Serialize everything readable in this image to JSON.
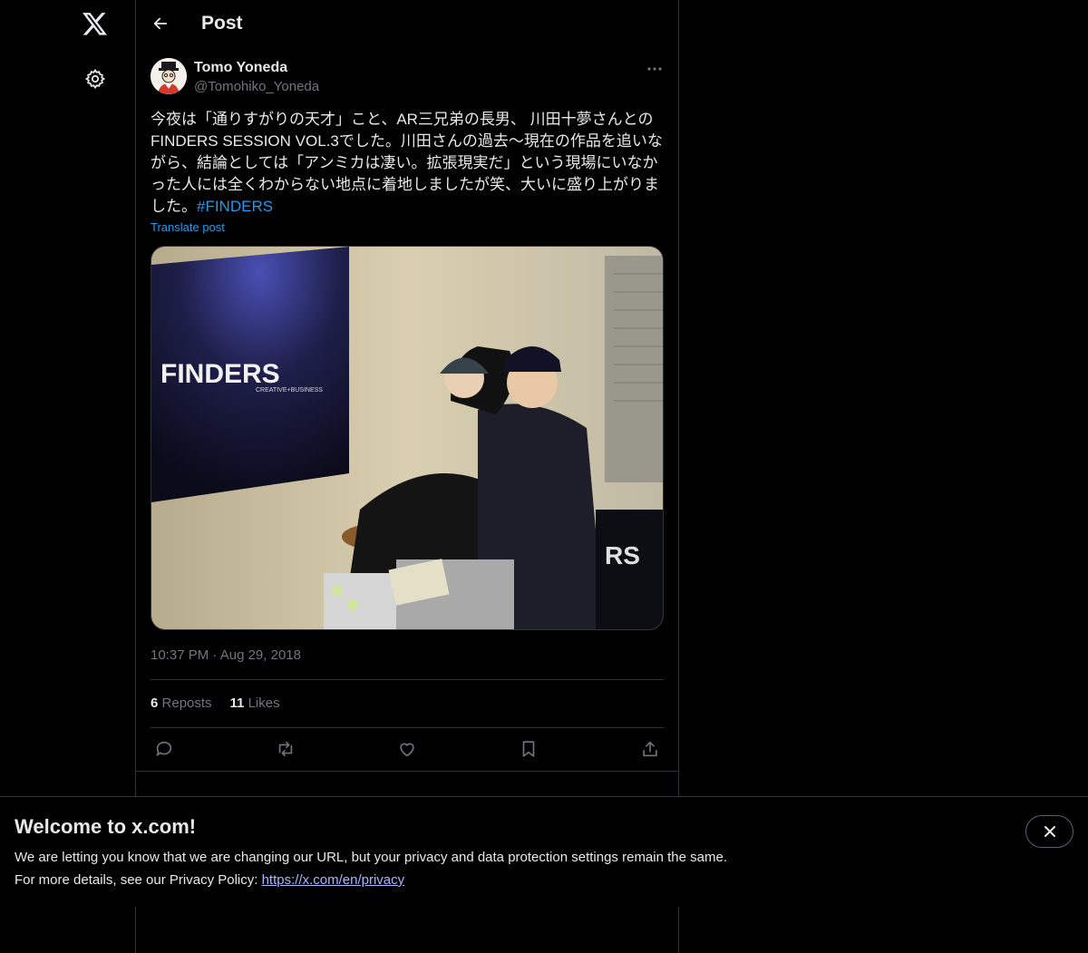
{
  "nav": {
    "logo_icon": "x-logo-icon",
    "settings_icon": "gear-icon"
  },
  "header": {
    "back_icon": "arrow-left-icon",
    "title": "Post"
  },
  "post": {
    "author_name": "Tomo Yoneda",
    "author_handle": "@Tomohiko_Yoneda",
    "text": "今夜は「通りすがりの天才」こと、AR三兄弟の長男、 川田十夢さんとのFINDERS SESSION VOL.3でした。川田さんの過去〜現在の作品を追いながら、結論としては「アンミカは凄い。拡張現実だ」という現場にいなかった人には全くわからない地点に着地しましたが笑、大いに盛り上がりました。",
    "hashtag": "#FINDERS",
    "translate_label": "Translate post",
    "photo_sign_text": "FINDERS",
    "photo_sign_subtext": "CREATIVE+BUSINESS",
    "time": "10:37 PM",
    "date_separator": "·",
    "date": "Aug 29, 2018",
    "reposts_count": "6",
    "reposts_label": "Reposts",
    "likes_count": "11",
    "likes_label": "Likes"
  },
  "actions": [
    "reply-icon",
    "repost-icon",
    "like-icon",
    "bookmark-icon",
    "share-icon"
  ],
  "banner": {
    "title": "Welcome to x.com!",
    "line1": "We are letting you know that we are changing our URL, but your privacy and data protection settings remain the same.",
    "line2_prefix": "For more details, see our Privacy Policy: ",
    "link_text": "https://x.com/en/privacy",
    "close_icon": "close-icon"
  },
  "colors": {
    "background": "#000000",
    "text": "#e7e9ea",
    "muted": "#71767b",
    "accent": "#1d9bf0",
    "border": "#2f3336"
  }
}
